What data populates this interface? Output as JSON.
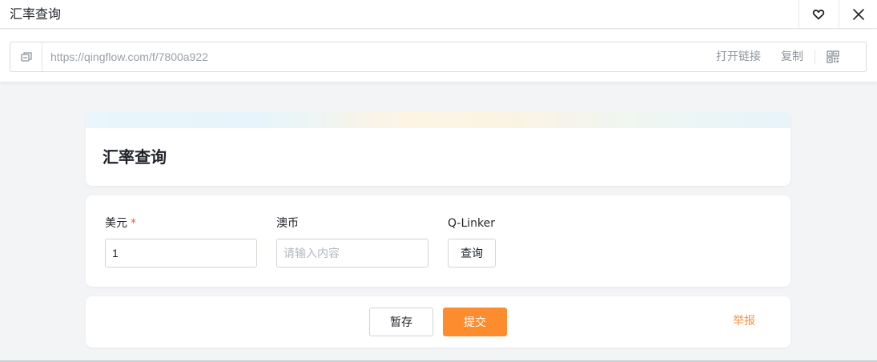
{
  "window": {
    "title": "汇率查询",
    "favorite_icon": "heart-icon",
    "close_icon": "close-icon"
  },
  "urlbar": {
    "icon": "link-copy-icon",
    "url": "https://qingflow.com/f/7800a922",
    "open_link_label": "打开链接",
    "copy_label": "复制",
    "qr_icon": "qrcode-icon"
  },
  "form": {
    "title": "汇率查询",
    "fields": [
      {
        "label": "美元",
        "required_mark": "*",
        "value": "1",
        "placeholder": ""
      },
      {
        "label": "澳币",
        "required_mark": "",
        "value": "",
        "placeholder": "请输入内容"
      }
    ],
    "linker": {
      "label": "Q-Linker",
      "button_label": "查询"
    }
  },
  "actions": {
    "draft_label": "暂存",
    "submit_label": "提交",
    "report_label": "举报"
  },
  "colors": {
    "accent": "#fd8c2f",
    "required": "#f5553d",
    "report": "#f5923e"
  }
}
